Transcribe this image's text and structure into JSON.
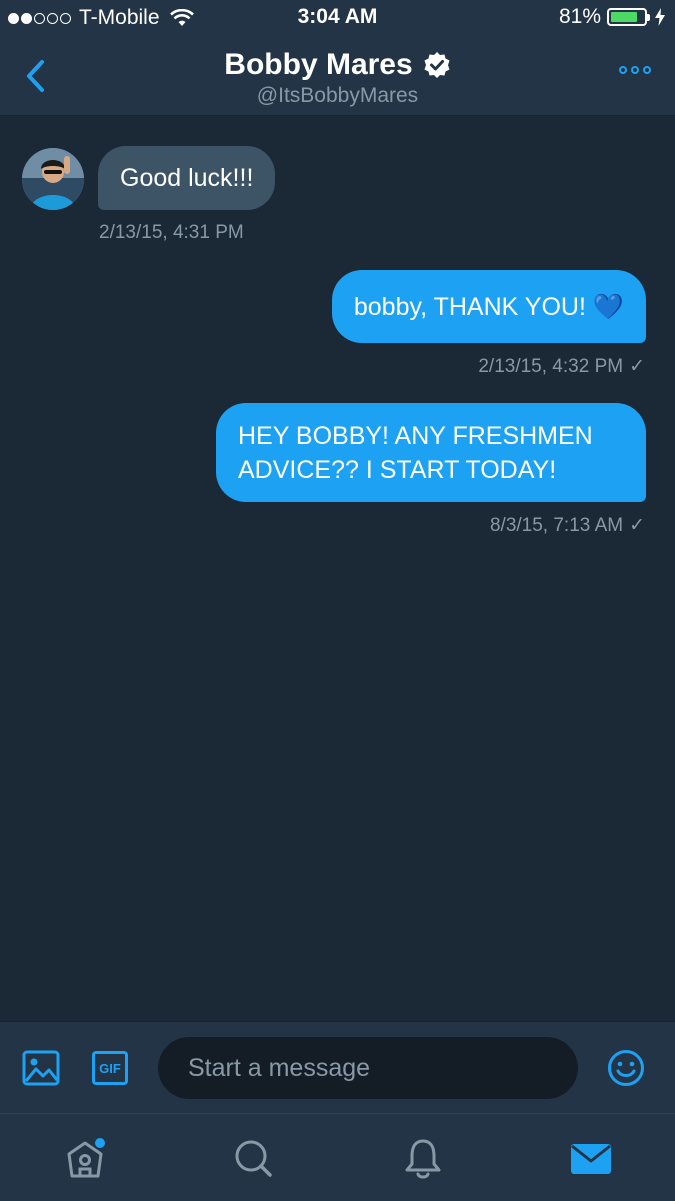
{
  "status_bar": {
    "carrier": "T-Mobile",
    "time": "3:04 AM",
    "battery_percent": "81%",
    "battery_level": 0.81,
    "signal_bars": 2
  },
  "header": {
    "name": "Bobby Mares",
    "handle": "@ItsBobbyMares",
    "verified": true
  },
  "messages": [
    {
      "direction": "incoming",
      "text": "Good luck!!!",
      "timestamp": "2/13/15, 4:31 PM"
    },
    {
      "direction": "outgoing",
      "text": "bobby, THANK YOU! 💙",
      "timestamp": "2/13/15, 4:32 PM",
      "status": "✓"
    },
    {
      "direction": "outgoing",
      "text": "HEY BOBBY! ANY FRESHMEN ADVICE?? I START TODAY!",
      "timestamp": "8/3/15, 7:13 AM",
      "status": "✓"
    }
  ],
  "composer": {
    "placeholder": "Start a message",
    "gif_label": "GIF"
  },
  "tabs": [
    {
      "name": "home-icon",
      "badge": true
    },
    {
      "name": "search-icon"
    },
    {
      "name": "notifications-icon"
    },
    {
      "name": "messages-icon",
      "active": true
    }
  ],
  "colors": {
    "accent": "#1da1f2",
    "background": "#1b2836",
    "bar": "#243447",
    "incoming_bubble": "#3d5466",
    "muted_text": "#8899a6"
  }
}
